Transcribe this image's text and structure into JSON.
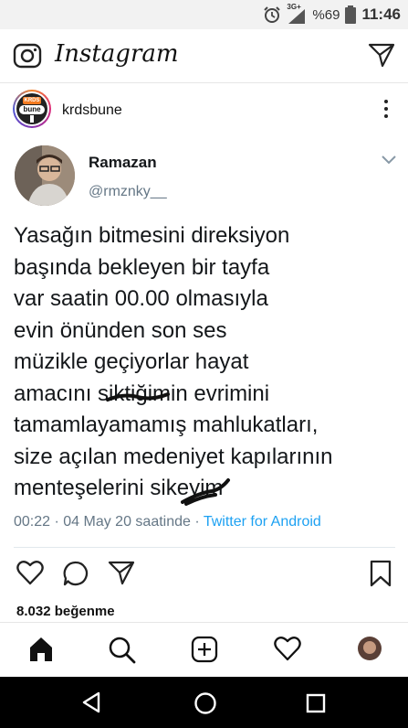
{
  "status_bar": {
    "network": "3G+",
    "battery": "%69",
    "time": "11:46"
  },
  "header": {
    "app_name": "Instagram"
  },
  "post": {
    "account": "krdsbune",
    "avatar_text_top": "KRDS",
    "avatar_text_main": "bune"
  },
  "tweet": {
    "name": "Ramazan",
    "handle": "@rmznky__",
    "lines": [
      "Yasağın bitmesini direksiyon",
      "başında bekleyen bir tayfa",
      "var saatin 00.00 olmasıyla",
      "evin önünden son ses",
      "müzikle geçiyorlar hayat",
      "amacını siktiğimin evrimini",
      "tamamlayamamış mahlukatları,",
      "size açılan medeniyet kapılarının",
      "menteşelerini sikeyim"
    ],
    "time_meta": "00:22 · 04 May 20 saatinde · ",
    "source": "Twitter for Android"
  },
  "likes": "8.032 beğenme",
  "icons": {
    "camera": "camera-icon",
    "direct": "direct-message-icon",
    "more": "more-options-icon",
    "like": "heart-icon",
    "comment": "comment-icon",
    "share": "share-icon",
    "save": "bookmark-icon",
    "home": "home-icon",
    "search": "search-icon",
    "add": "add-post-icon",
    "activity": "heart-icon",
    "profile": "profile-avatar"
  },
  "colors": {
    "twitter_link": "#1da1f2",
    "handle_gray": "#657786"
  }
}
